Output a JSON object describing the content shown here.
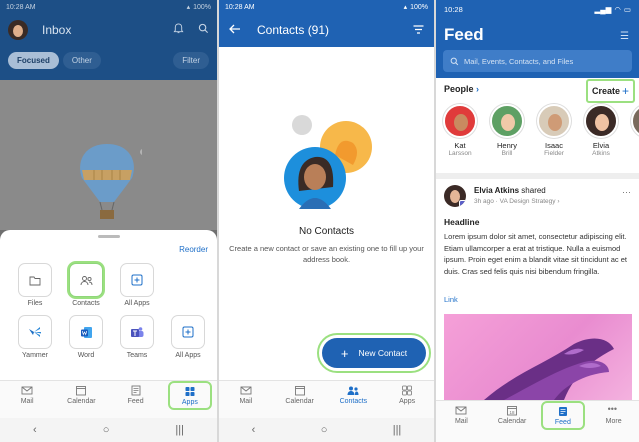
{
  "phone1": {
    "status": {
      "time": "10:28 AM",
      "battery": "100%"
    },
    "header": {
      "title": "Inbox"
    },
    "tabs": {
      "focused": "Focused",
      "other": "Other",
      "filter": "Filter"
    },
    "sheet": {
      "reorder": "Reorder",
      "apps": [
        {
          "label": "Files",
          "icon": "folder-icon"
        },
        {
          "label": "Contacts",
          "icon": "contacts-icon",
          "highlighted": true
        },
        {
          "label": "All Apps",
          "icon": "add-app-icon"
        },
        {
          "label": "",
          "icon": "blank"
        },
        {
          "label": "Yammer",
          "icon": "yammer-icon"
        },
        {
          "label": "Word",
          "icon": "word-icon"
        },
        {
          "label": "Teams",
          "icon": "teams-icon"
        },
        {
          "label": "All Apps",
          "icon": "add-app-icon"
        }
      ]
    },
    "nav": {
      "mail": "Mail",
      "calendar": "Calendar",
      "feed": "Feed",
      "apps": "Apps"
    }
  },
  "phone2": {
    "status": {
      "time": "10:28 AM",
      "battery": "100%"
    },
    "title": "Contacts (91)",
    "empty_title": "No Contacts",
    "empty_desc": "Create a new contact or save an existing one to fill up your address book.",
    "fab": "New Contact",
    "nav": {
      "mail": "Mail",
      "calendar": "Calendar",
      "contacts": "Contacts",
      "apps": "Apps"
    }
  },
  "phone3": {
    "status": {
      "time": "10:28"
    },
    "title": "Feed",
    "search_placeholder": "Mail, Events, Contacts, and Files",
    "people_heading": "People",
    "create": "Create",
    "people": [
      {
        "name": "Kat",
        "sub": "Larsson"
      },
      {
        "name": "Henry",
        "sub": "Brill"
      },
      {
        "name": "Isaac",
        "sub": "Fielder"
      },
      {
        "name": "Elvia",
        "sub": "Atkins"
      },
      {
        "name": "An",
        "sub": "A"
      }
    ],
    "post": {
      "author": "Elvia Atkins",
      "action": "shared",
      "meta": "3h ago · VA Design Strategy ›",
      "headline": "Headline",
      "body": "Lorem ipsum dolor sit amet, consectetur adipiscing elit. Etiam ullamcorper a erat at tristique. Nulla a euismod ipsum. Proin eget enim a blandit vitae sit tincidunt ac et duis. Cras sed felis quis nisi bibendum fringilla.",
      "link": "Link"
    },
    "nav": {
      "mail": "Mail",
      "calendar": "Calendar",
      "feed": "Feed",
      "more": "More",
      "calendar_day": "18"
    }
  }
}
